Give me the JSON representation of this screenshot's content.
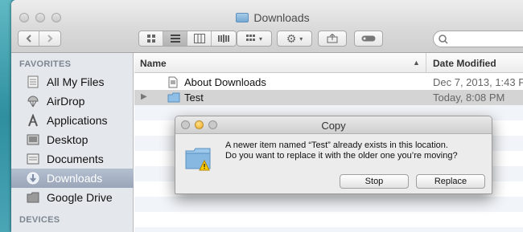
{
  "window": {
    "title": "Downloads",
    "title_icon": "folder-icon"
  },
  "toolbar": {
    "back_icon": "chevron-left-icon",
    "forward_icon": "chevron-right-icon",
    "views": [
      "icon-view-icon",
      "list-view-icon",
      "column-view-icon",
      "coverflow-view-icon"
    ],
    "arrange_icon": "grid-icon",
    "action_icon": "gear-icon",
    "share_icon": "share-icon",
    "tags_icon": "tag-icon",
    "search_icon": "search-icon"
  },
  "sidebar": {
    "favorites_heading": "FAVORITES",
    "devices_heading": "DEVICES",
    "items": [
      {
        "label": "All My Files",
        "icon": "all-files-icon"
      },
      {
        "label": "AirDrop",
        "icon": "airdrop-icon"
      },
      {
        "label": "Applications",
        "icon": "applications-icon"
      },
      {
        "label": "Desktop",
        "icon": "desktop-icon"
      },
      {
        "label": "Documents",
        "icon": "documents-icon"
      },
      {
        "label": "Downloads",
        "icon": "downloads-icon",
        "selected": true
      },
      {
        "label": "Google Drive",
        "icon": "folder-icon"
      }
    ]
  },
  "list": {
    "columns": {
      "name": "Name",
      "date": "Date Modified"
    },
    "rows": [
      {
        "name": "About Downloads",
        "date": "Dec 7, 2013, 1:43 P",
        "icon": "document-icon"
      },
      {
        "name": "Test",
        "date": "Today, 8:08 PM",
        "icon": "folder-icon",
        "selected": true
      }
    ]
  },
  "dialog": {
    "title": "Copy",
    "message_line1": "A newer item named “Test” already exists in this location.",
    "message_line2": "Do you want to replace it with the older one you’re moving?",
    "icon": "folder-warning-icon",
    "buttons": {
      "stop": "Stop",
      "replace": "Replace"
    }
  }
}
